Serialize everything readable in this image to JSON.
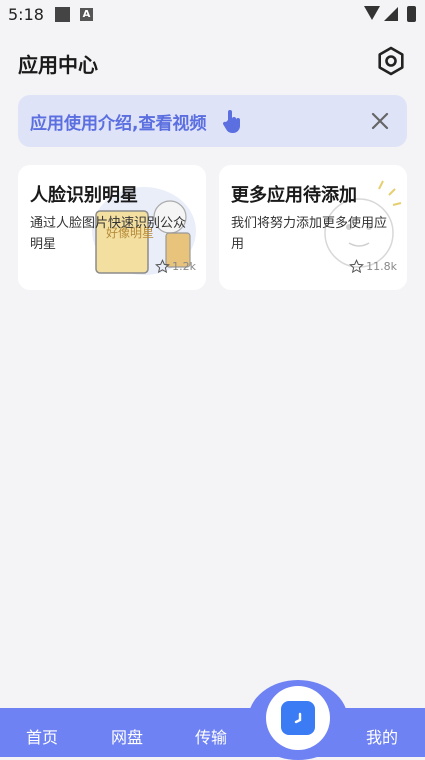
{
  "status_bar": {
    "time": "5:18",
    "icon_letter": "A"
  },
  "header": {
    "title": "应用中心"
  },
  "banner": {
    "text": "应用使用介绍,查看视频"
  },
  "cards": [
    {
      "title": "人脸识别明星",
      "desc": "通过人脸图片快速识别公众明星",
      "stars": "1.2k",
      "art_text": "好像明星"
    },
    {
      "title": "更多应用待添加",
      "desc": "我们将努力添加更多使用应用",
      "stars": "11.8k"
    }
  ],
  "nav": {
    "home": "首页",
    "disk": "网盘",
    "transfer": "传输",
    "mine": "我的"
  },
  "colors": {
    "accent": "#6f82f3",
    "banner_text": "#5b6fe0",
    "center_button": "#3b7cf5"
  }
}
